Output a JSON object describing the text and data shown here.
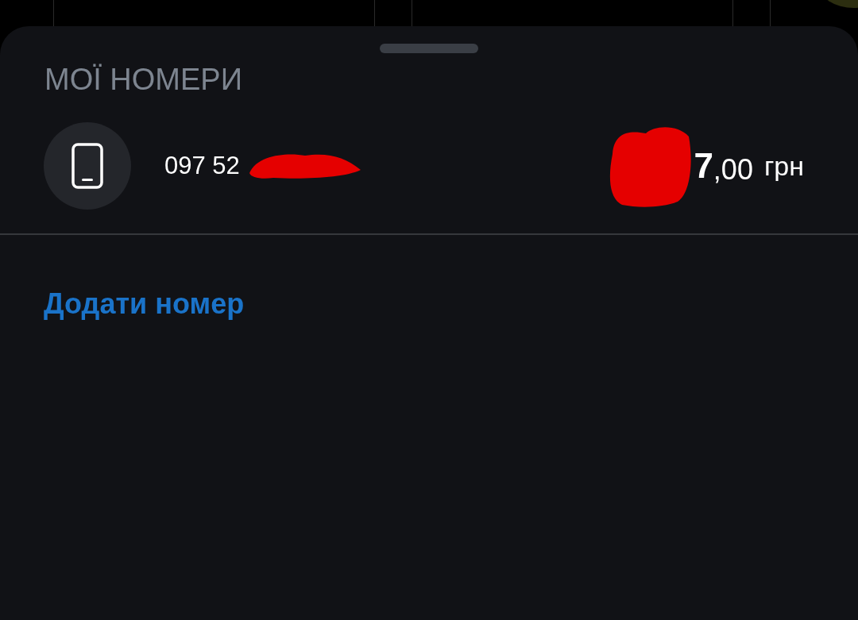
{
  "sheet": {
    "title": "МОЇ НОМЕРИ",
    "numbers": [
      {
        "phone": "097 52",
        "balance_main": "7",
        "balance_fraction": ",00",
        "currency": "грн"
      }
    ],
    "add_link": "Додати номер"
  }
}
